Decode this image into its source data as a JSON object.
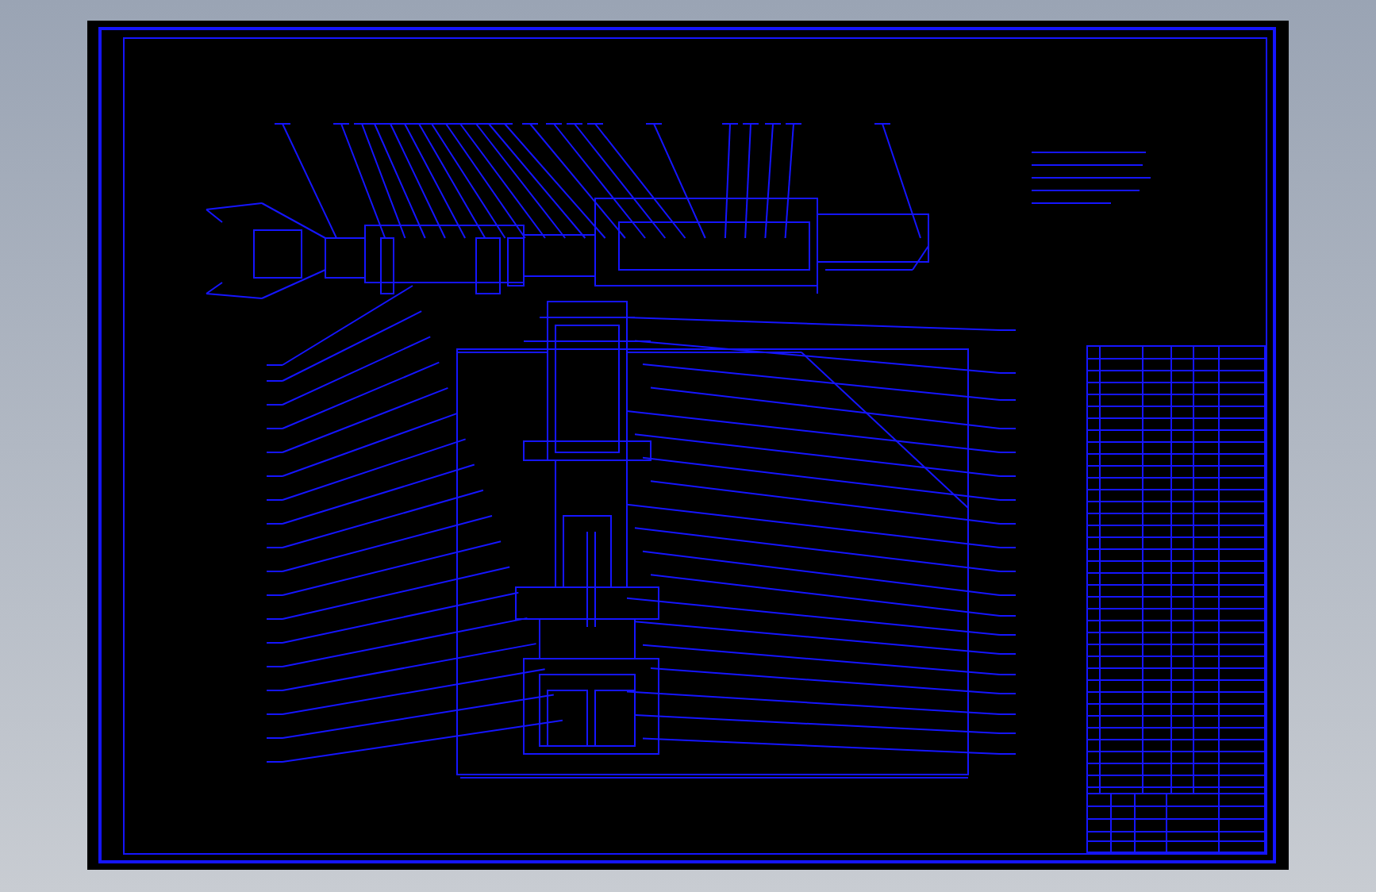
{
  "sheet": {
    "kind": "assembly-drawing"
  }
}
